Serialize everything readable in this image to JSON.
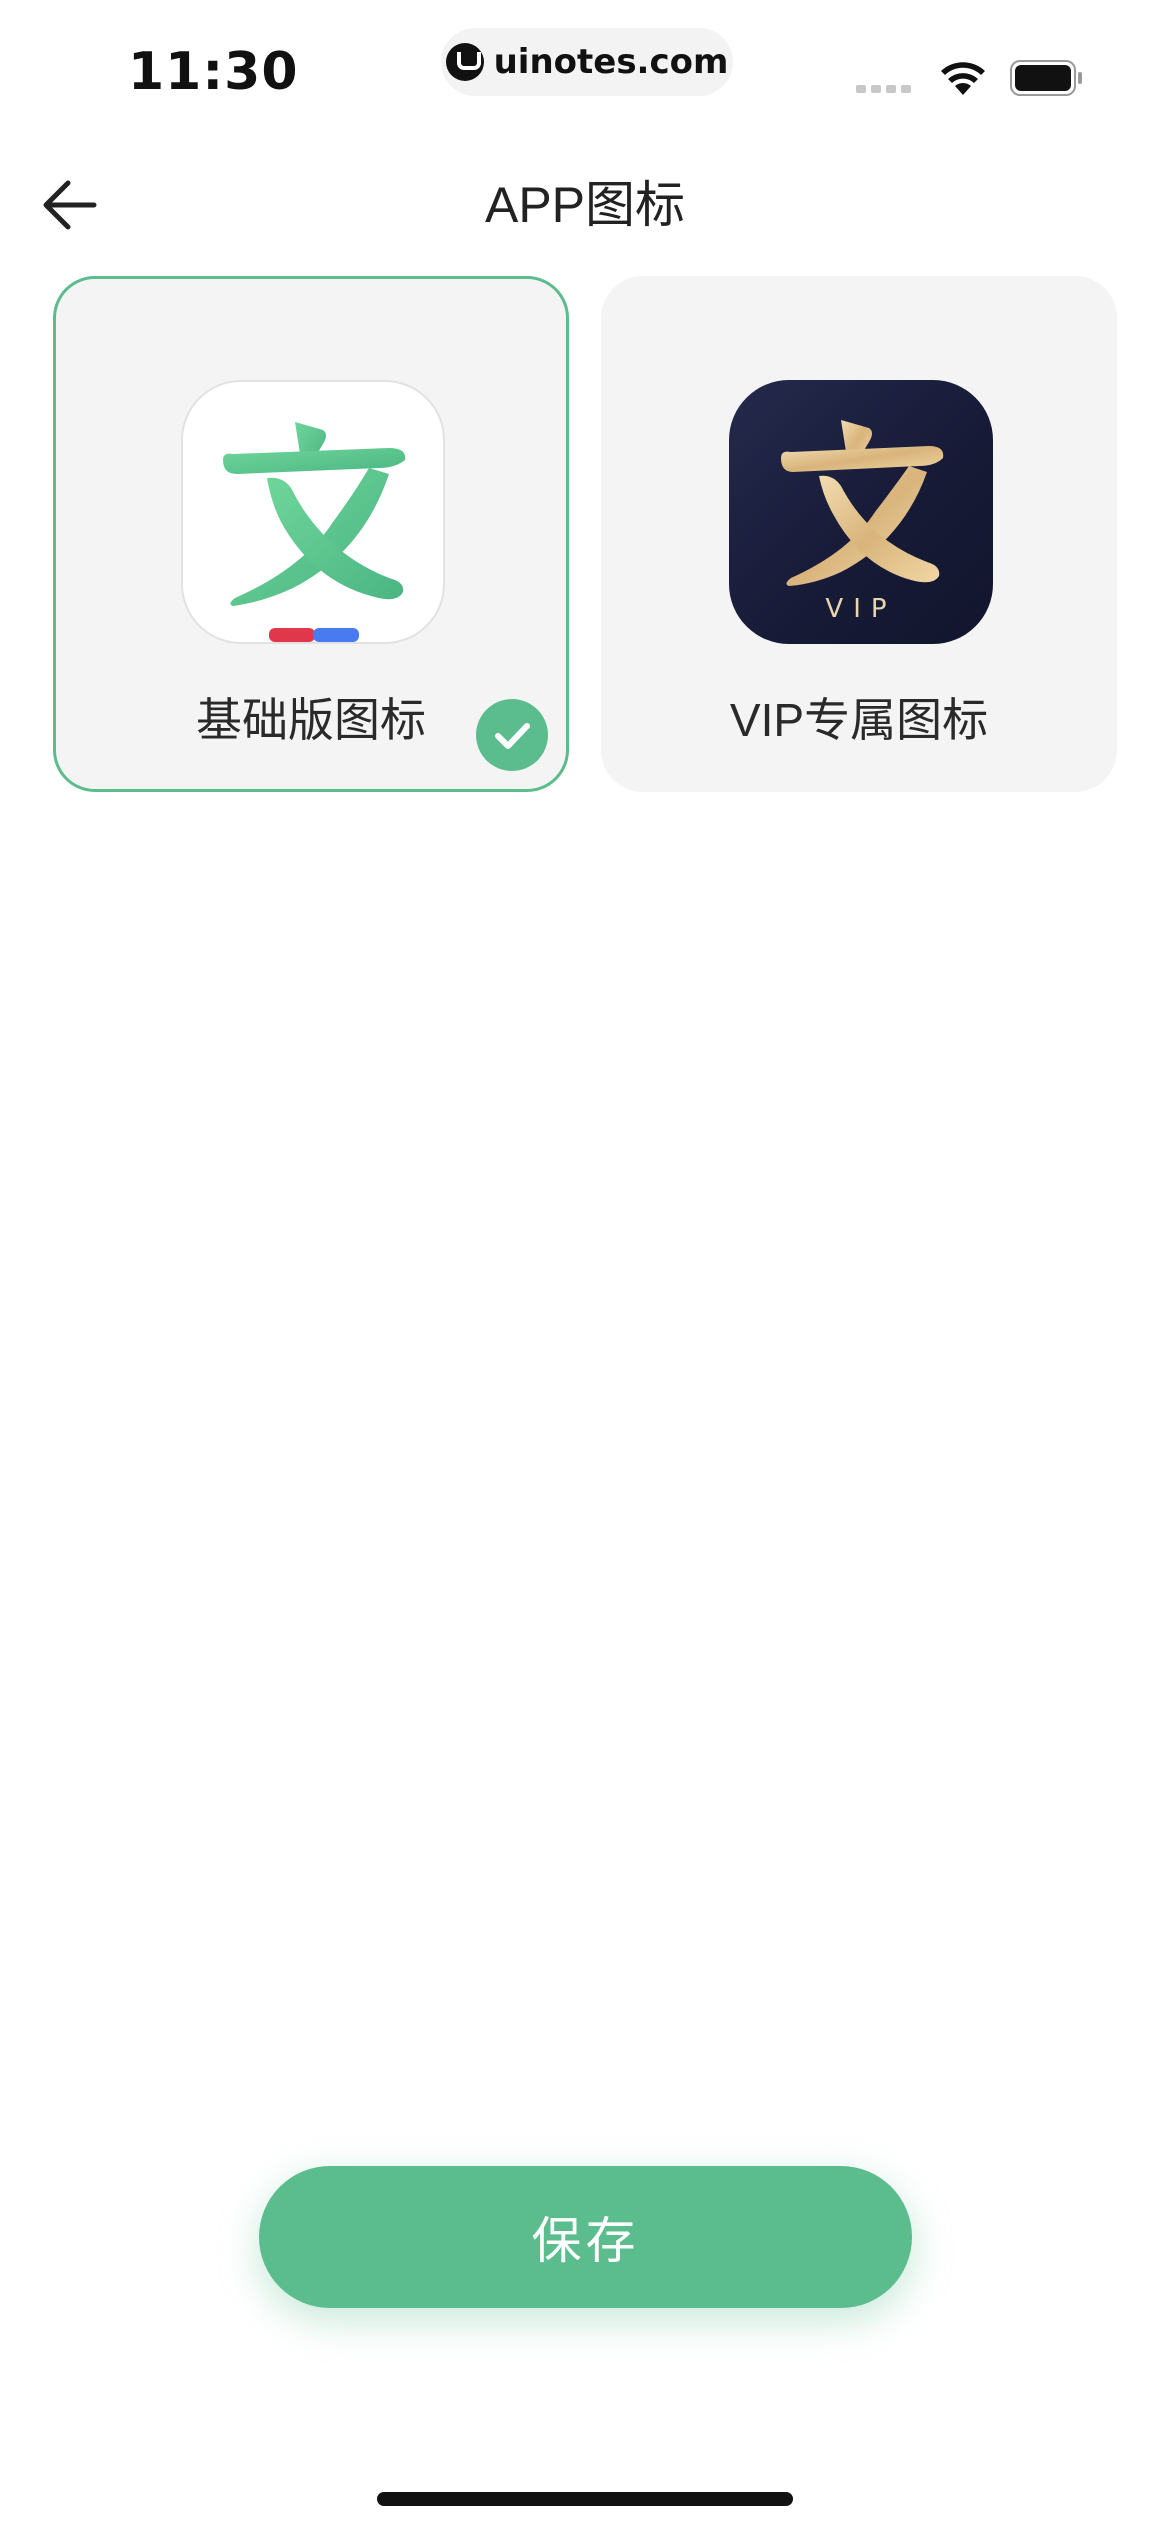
{
  "status_bar": {
    "time": "11:30",
    "url": "uinotes.com",
    "icons": [
      "signal-icon",
      "wifi-icon",
      "battery-icon"
    ]
  },
  "nav": {
    "back_icon": "arrow-left-icon",
    "title": "APP图标"
  },
  "icons": [
    {
      "label": "基础版图标",
      "glyph": "文",
      "selected": true,
      "style": "basic"
    },
    {
      "label": "VIP专属图标",
      "glyph": "文",
      "badge_text": "VIP",
      "selected": false,
      "style": "vip"
    }
  ],
  "selected_icon": "check-icon",
  "save_button": {
    "label": "保存"
  },
  "colors": {
    "accent": "#5bbc8e",
    "card_bg": "#f4f4f4",
    "vip_bg": "#1b1f3d",
    "vip_gold": "#e3c48e",
    "basic_red": "#e0374a",
    "basic_blue": "#4a7af0"
  }
}
